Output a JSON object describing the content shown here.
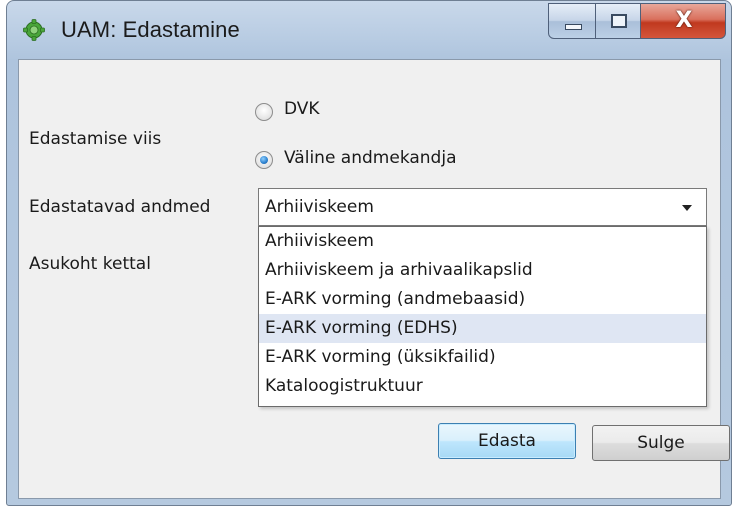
{
  "window": {
    "title": "UAM: Edastamine",
    "close_glyph": "X"
  },
  "icons": {
    "app": "green-gear-icon",
    "minimize": "minimize-icon",
    "maximize": "maximize-icon",
    "close": "close-icon",
    "dropdown": "chevron-down-icon"
  },
  "form": {
    "method_label": "Edastamise viis",
    "method_options": [
      {
        "label": "DVK",
        "checked": false
      },
      {
        "label": "Väline andmekandja",
        "checked": true
      }
    ],
    "data_label": "Edastatavad andmed",
    "data_selected": "Arhiiviskeem",
    "location_label": "Asukoht kettal",
    "dropdown_options": [
      "Arhiiviskeem",
      "Arhiiviskeem ja arhivaalikapslid",
      "E-ARK vorming (andmebaasid)",
      "E-ARK vorming (EDHS)",
      "E-ARK vorming (üksikfailid)",
      "Kataloogistruktuur"
    ],
    "dropdown_highlighted_index": 3
  },
  "buttons": {
    "submit": "Edasta",
    "close": "Sulge"
  },
  "colors": {
    "highlight": "#dfe6f3",
    "client_bg": "#f0f0f0",
    "close_button": "#c0391f"
  }
}
